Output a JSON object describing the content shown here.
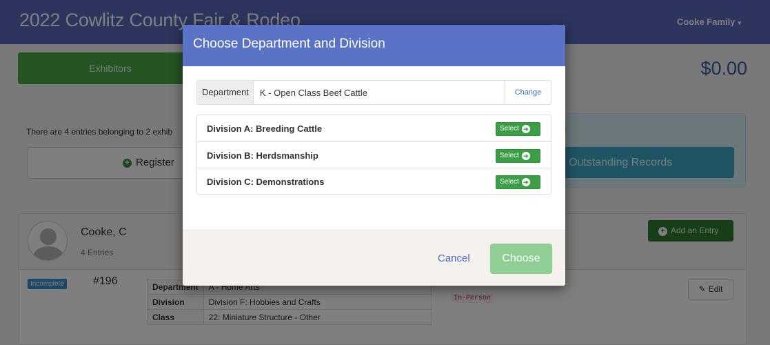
{
  "app": {
    "title": "2022 Cowlitz County Fair & Rodeo",
    "account_menu": "Cooke Family",
    "total": "$0.00"
  },
  "nav": {
    "exhibitors_label": "Exhibitors"
  },
  "summary": {
    "text": "There are 4 entries belonging to 2 exhib",
    "register_label": "Register",
    "info_partial": "n",
    "outstanding_label": "Outstanding Records"
  },
  "exhibitor": {
    "name": "Cooke, C",
    "entries": "4 Entries",
    "add_entry_label": "Add an Entry"
  },
  "entry": {
    "status": "Incomplete",
    "number": "#196",
    "rows": [
      {
        "key": "Department",
        "value": "A - Home Arts"
      },
      {
        "key": "Division",
        "value": "Division F: Hobbies and Crafts"
      },
      {
        "key": "Class",
        "value": "22: Miniature Structure - Other"
      }
    ],
    "delivery": "In-Person",
    "edit_label": "Edit"
  },
  "modal": {
    "title": "Choose Department and Division",
    "department_label": "Department",
    "department_value": "K - Open Class Beef Cattle",
    "change_label": "Change",
    "divisions": [
      {
        "name": "Division A: Breeding Cattle",
        "select_label": "Select"
      },
      {
        "name": "Division B: Herdsmanship",
        "select_label": "Select"
      },
      {
        "name": "Division C: Demonstrations",
        "select_label": "Select"
      }
    ],
    "cancel_label": "Cancel",
    "choose_label": "Choose"
  },
  "icons": {
    "plus": "plus-circle-icon",
    "arrow": "arrow-right-circle-icon",
    "pencil": "pencil-icon",
    "caret": "caret-down-icon"
  },
  "colors": {
    "header": "#5b6bbf",
    "modal_header": "#5b73c7",
    "success": "#4aa84a",
    "info": "#3fa8c8",
    "link": "#3b6fc8"
  }
}
